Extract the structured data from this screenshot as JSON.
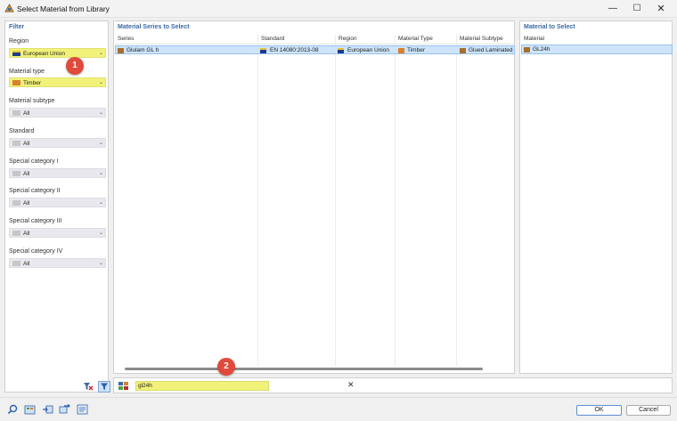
{
  "window": {
    "title": "Select Material from Library",
    "minimize_glyph": "—",
    "maximize_glyph": "☐",
    "close_glyph": "✕"
  },
  "filter": {
    "title": "Filter",
    "fields": [
      {
        "label": "Region",
        "value": "European Union",
        "swatch": "flag",
        "highlighted": true
      },
      {
        "label": "Material type",
        "value": "Timber",
        "swatch": "orange",
        "highlighted": true
      },
      {
        "label": "Material subtype",
        "value": "All",
        "swatch": "grey",
        "highlighted": false
      },
      {
        "label": "Standard",
        "value": "All",
        "swatch": "grey",
        "highlighted": false
      },
      {
        "label": "Special category I",
        "value": "All",
        "swatch": "grey",
        "highlighted": false
      },
      {
        "label": "Special category II",
        "value": "All",
        "swatch": "grey",
        "highlighted": false
      },
      {
        "label": "Special category III",
        "value": "All",
        "swatch": "grey",
        "highlighted": false
      },
      {
        "label": "Special category IV",
        "value": "All",
        "swatch": "grey",
        "highlighted": false
      }
    ],
    "dropdown_glyph": "⌄",
    "clear_filter_icon": "clear-filter-icon",
    "filter_icon": "filter-icon"
  },
  "series": {
    "title": "Material Series to Select",
    "columns": [
      "Series",
      "Standard",
      "Region",
      "Material Type",
      "Material Subtype"
    ],
    "rows": [
      {
        "series": "Glulam GL h",
        "standard": "EN 14080:2013-08",
        "region": "European Union",
        "material_type": "Timber",
        "material_subtype": "Glued Laminated Timber"
      }
    ]
  },
  "material": {
    "title": "Material to Select",
    "column": "Material",
    "items": [
      "GL24h"
    ]
  },
  "search": {
    "value": "gl24h",
    "clear_glyph": "✕"
  },
  "badges": [
    "1",
    "2"
  ],
  "bottom_toolbar": [
    "search-icon",
    "library-icon",
    "import-icon",
    "export-icon",
    "info-icon"
  ],
  "buttons": {
    "ok": "OK",
    "cancel": "Cancel"
  },
  "colors": {
    "highlight": "#f2f27a",
    "selection": "#cde4fa",
    "accent": "#3b6aa8",
    "badge": "#e04a3b",
    "timber": "#d9812b"
  }
}
